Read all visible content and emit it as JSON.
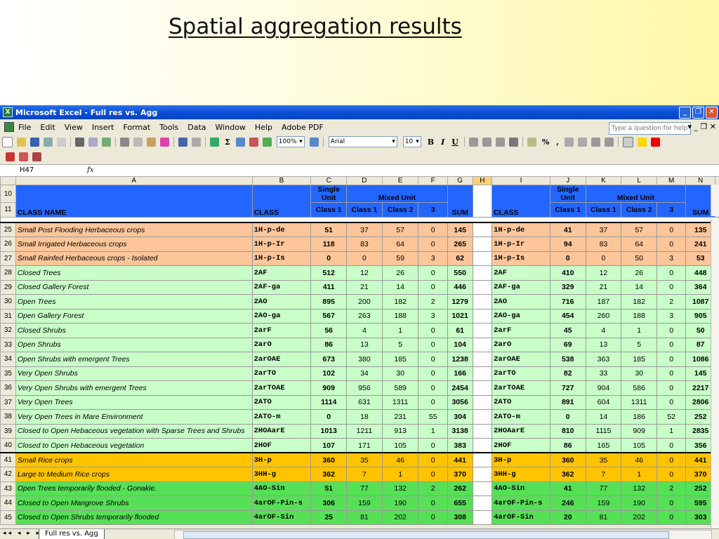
{
  "slide": {
    "title": "Spatial aggregation results"
  },
  "window": {
    "title": "Microsoft Excel - Full res vs. Agg",
    "app_icon_letter": "X",
    "minimize": "_",
    "restore": "❐",
    "close": "✕"
  },
  "menu": {
    "items": [
      "File",
      "Edit",
      "View",
      "Insert",
      "Format",
      "Tools",
      "Data",
      "Window",
      "Help",
      "Adobe PDF"
    ],
    "help_placeholder": "Type a question for help",
    "controls": "▾  _  ❐  ✕"
  },
  "toolbar": {
    "zoom": "100%",
    "font": "Arial",
    "font_size": "10",
    "bold": "B",
    "italic": "I",
    "underline": "U",
    "sigma": "Σ",
    "percent": "%",
    "comma": ","
  },
  "formula_bar": {
    "cell_ref": "H47",
    "fx": "fx",
    "content": ""
  },
  "columns": [
    "A",
    "B",
    "C",
    "D",
    "E",
    "F",
    "G",
    "H",
    "I",
    "J",
    "K",
    "L",
    "M",
    "N"
  ],
  "header": {
    "row_a": "10",
    "row_b": "11",
    "class_name": "CLASS NAME",
    "class": "CLASS",
    "single_unit_1": "Single",
    "single_unit_2": "Unit",
    "mixed_unit": "Mixed Unit",
    "class1": "Class 1",
    "class2": "Class 2",
    "three": "3",
    "sum": "SUM"
  },
  "colors": {
    "header_blue": "#2266ff",
    "orange": "#fcc69a",
    "light_green": "#c9fec9",
    "gold": "#ffc300",
    "green": "#55e055",
    "selected_col": "#ffffff"
  },
  "rows": [
    {
      "row": "25",
      "group": "orange",
      "name": "Small Post Flooding Herbaceous crops",
      "code": "1H-p-de",
      "c": "51",
      "d": "37",
      "e": "57",
      "f": "0",
      "g": "145",
      "i": "1H-p-de",
      "j": "41",
      "k": "37",
      "l": "57",
      "m": "0",
      "n": "135"
    },
    {
      "row": "26",
      "group": "orange",
      "name": "Small Irrigated Herbaceous crops",
      "code": "1H-p-Ir",
      "c": "118",
      "d": "83",
      "e": "64",
      "f": "0",
      "g": "265",
      "i": "1H-p-Ir",
      "j": "94",
      "k": "83",
      "l": "64",
      "m": "0",
      "n": "241"
    },
    {
      "row": "27",
      "group": "orange",
      "name": "Small Rainfed Herbaceous crops - Isolated",
      "code": "1H-p-Is",
      "c": "0",
      "d": "0",
      "e": "59",
      "f": "3",
      "g": "62",
      "i": "1H-p-Is",
      "j": "0",
      "k": "0",
      "l": "50",
      "m": "3",
      "n": "53"
    },
    {
      "row": "28",
      "group": "light_green",
      "name": "Closed Trees",
      "code": "2AF",
      "c": "512",
      "d": "12",
      "e": "26",
      "f": "0",
      "g": "550",
      "i": "2AF",
      "j": "410",
      "k": "12",
      "l": "26",
      "m": "0",
      "n": "448"
    },
    {
      "row": "29",
      "group": "light_green",
      "name": "Closed Gallery Forest",
      "code": "2AF-ga",
      "c": "411",
      "d": "21",
      "e": "14",
      "f": "0",
      "g": "446",
      "i": "2AF-ga",
      "j": "329",
      "k": "21",
      "l": "14",
      "m": "0",
      "n": "364"
    },
    {
      "row": "30",
      "group": "light_green",
      "name": "Open Trees",
      "code": "2AO",
      "c": "895",
      "d": "200",
      "e": "182",
      "f": "2",
      "g": "1279",
      "i": "2AO",
      "j": "716",
      "k": "187",
      "l": "182",
      "m": "2",
      "n": "1087"
    },
    {
      "row": "31",
      "group": "light_green",
      "name": "Open Gallery Forest",
      "code": "2AO-ga",
      "c": "567",
      "d": "263",
      "e": "188",
      "f": "3",
      "g": "1021",
      "i": "2AO-ga",
      "j": "454",
      "k": "260",
      "l": "188",
      "m": "3",
      "n": "905"
    },
    {
      "row": "32",
      "group": "light_green",
      "name": "Closed Shrubs",
      "code": "2arF",
      "c": "56",
      "d": "4",
      "e": "1",
      "f": "0",
      "g": "61",
      "i": "2arF",
      "j": "45",
      "k": "4",
      "l": "1",
      "m": "0",
      "n": "50"
    },
    {
      "row": "33",
      "group": "light_green",
      "name": "Open Shrubs",
      "code": "2arO",
      "c": "86",
      "d": "13",
      "e": "5",
      "f": "0",
      "g": "104",
      "i": "2arO",
      "j": "69",
      "k": "13",
      "l": "5",
      "m": "0",
      "n": "87"
    },
    {
      "row": "34",
      "group": "light_green",
      "name": "Open Shrubs with emergent Trees",
      "code": "2arOAE",
      "c": "673",
      "d": "380",
      "e": "185",
      "f": "0",
      "g": "1238",
      "i": "2arOAE",
      "j": "538",
      "k": "363",
      "l": "185",
      "m": "0",
      "n": "1086"
    },
    {
      "row": "35",
      "group": "light_green",
      "name": "Very Open Shrubs",
      "code": "2arTO",
      "c": "102",
      "d": "34",
      "e": "30",
      "f": "0",
      "g": "166",
      "i": "2arTO",
      "j": "82",
      "k": "33",
      "l": "30",
      "m": "0",
      "n": "145"
    },
    {
      "row": "36",
      "group": "light_green",
      "name": "Very Open Shrubs with emergent Trees",
      "code": "2arTOAE",
      "c": "909",
      "d": "956",
      "e": "589",
      "f": "0",
      "g": "2454",
      "i": "2arTOAE",
      "j": "727",
      "k": "904",
      "l": "586",
      "m": "0",
      "n": "2217"
    },
    {
      "row": "37",
      "group": "light_green",
      "name": "Very Open Trees",
      "code": "2ATO",
      "c": "1114",
      "d": "631",
      "e": "1311",
      "f": "0",
      "g": "3056",
      "i": "2ATO",
      "j": "891",
      "k": "604",
      "l": "1311",
      "m": "0",
      "n": "2806"
    },
    {
      "row": "38",
      "group": "light_green",
      "name": "Very Open Trees in Mare Environment",
      "code": "2ATO-m",
      "c": "0",
      "d": "18",
      "e": "231",
      "f": "55",
      "g": "304",
      "i": "2ATO-m",
      "j": "0",
      "k": "14",
      "l": "186",
      "m": "52",
      "n": "252"
    },
    {
      "row": "39",
      "group": "light_green",
      "name": "Closed to Open Hebaceous vegetation with Sparse Trees and Shrubs",
      "code": "2HOAarE",
      "c": "1013",
      "d": "1211",
      "e": "913",
      "f": "1",
      "g": "3138",
      "i": "2HOAarE",
      "j": "810",
      "k": "1115",
      "l": "909",
      "m": "1",
      "n": "2835"
    },
    {
      "row": "40",
      "group": "light_green",
      "name": "Closed to Open Hebaceous vegetation",
      "code": "2HOF",
      "c": "107",
      "d": "171",
      "e": "105",
      "f": "0",
      "g": "383",
      "i": "2HOF",
      "j": "86",
      "k": "165",
      "l": "105",
      "m": "0",
      "n": "356"
    },
    {
      "row": "41",
      "group": "gold",
      "name": "Small Rice crops",
      "code": "3H-p",
      "c": "360",
      "d": "35",
      "e": "46",
      "f": "0",
      "g": "441",
      "i": "3H-p",
      "j": "360",
      "k": "35",
      "l": "46",
      "m": "0",
      "n": "441"
    },
    {
      "row": "42",
      "group": "gold",
      "name": "Large to Medium Rice crops",
      "code": "3HH-g",
      "c": "362",
      "d": "7",
      "e": "1",
      "f": "0",
      "g": "370",
      "i": "3HH-g",
      "j": "362",
      "k": "7",
      "l": "1",
      "m": "0",
      "n": "370"
    },
    {
      "row": "43",
      "group": "green",
      "name": "Open Trees temporarily flooded - Gonakie.",
      "code": "4AO-Sin",
      "c": "51",
      "d": "77",
      "e": "132",
      "f": "2",
      "g": "262",
      "i": "4AO-Sin",
      "j": "41",
      "k": "77",
      "l": "132",
      "m": "2",
      "n": "252"
    },
    {
      "row": "44",
      "group": "green",
      "name": "Closed to Open Mangrove Shrubs",
      "code": "4arOF-Pin-s",
      "c": "306",
      "d": "159",
      "e": "190",
      "f": "0",
      "g": "655",
      "i": "4arOF-Pin-s",
      "j": "246",
      "k": "159",
      "l": "190",
      "m": "0",
      "n": "595"
    },
    {
      "row": "45",
      "group": "green",
      "name": "Closed to Open Shrubs temporarily flooded",
      "code": "4arOF-Sin",
      "c": "25",
      "d": "81",
      "e": "202",
      "f": "0",
      "g": "308",
      "i": "4arOF-Sin",
      "j": "20",
      "k": "81",
      "l": "202",
      "m": "0",
      "n": "303"
    }
  ],
  "sheet_tab": {
    "label": "Full res vs. Agg",
    "nav": "◂◂ ◂ ▸ ▸▸"
  }
}
